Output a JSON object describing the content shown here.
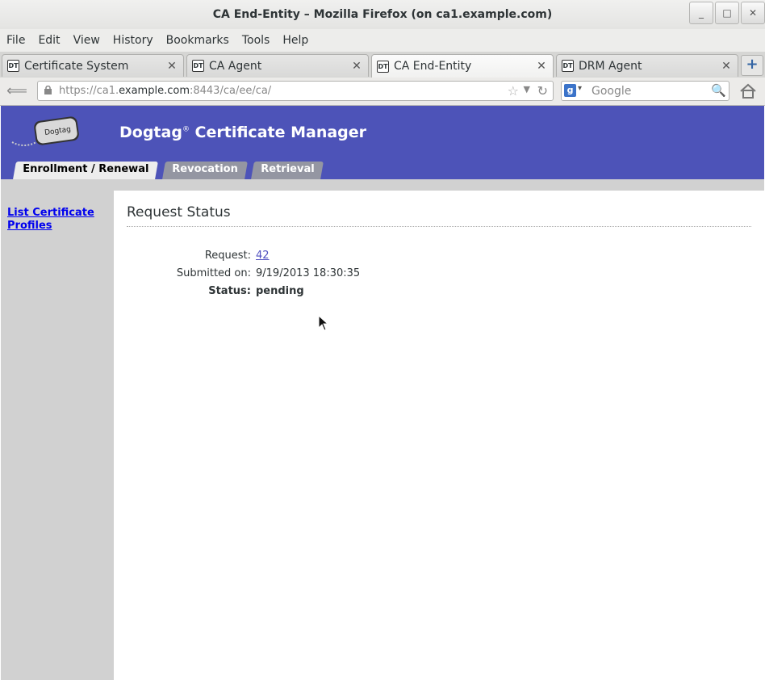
{
  "window": {
    "title": "CA End-Entity – Mozilla Firefox (on ca1.example.com)"
  },
  "menubar": [
    "File",
    "Edit",
    "View",
    "History",
    "Bookmarks",
    "Tools",
    "Help"
  ],
  "tabs": [
    {
      "label": "Certificate System",
      "favicon": "DT"
    },
    {
      "label": "CA Agent",
      "favicon": "DT"
    },
    {
      "label": "CA End-Entity",
      "favicon": "DT"
    },
    {
      "label": "DRM Agent",
      "favicon": "DT"
    }
  ],
  "navbar": {
    "url_prefix": "https://ca1.",
    "url_host": "example.com",
    "url_suffix": ":8443/ca/ee/ca/",
    "search_placeholder": "Google"
  },
  "banner": {
    "logo_text": "Dogtag",
    "brand": "Dogtag",
    "brand_mark": "®",
    "brand_rest": " Certificate Manager",
    "tabs": [
      "Enrollment / Renewal",
      "Revocation",
      "Retrieval"
    ]
  },
  "sidebar": {
    "link": "List Certificate Profiles"
  },
  "content": {
    "heading": "Request Status",
    "request_label": "Request:",
    "request_value": "42",
    "submitted_label": "Submitted on:",
    "submitted_value": "9/19/2013 18:30:35",
    "status_label": "Status:",
    "status_value": "pending"
  },
  "colors": {
    "banner": "#4d53b8",
    "sidebar": "#d1d1d1",
    "link": "#0000ee"
  }
}
